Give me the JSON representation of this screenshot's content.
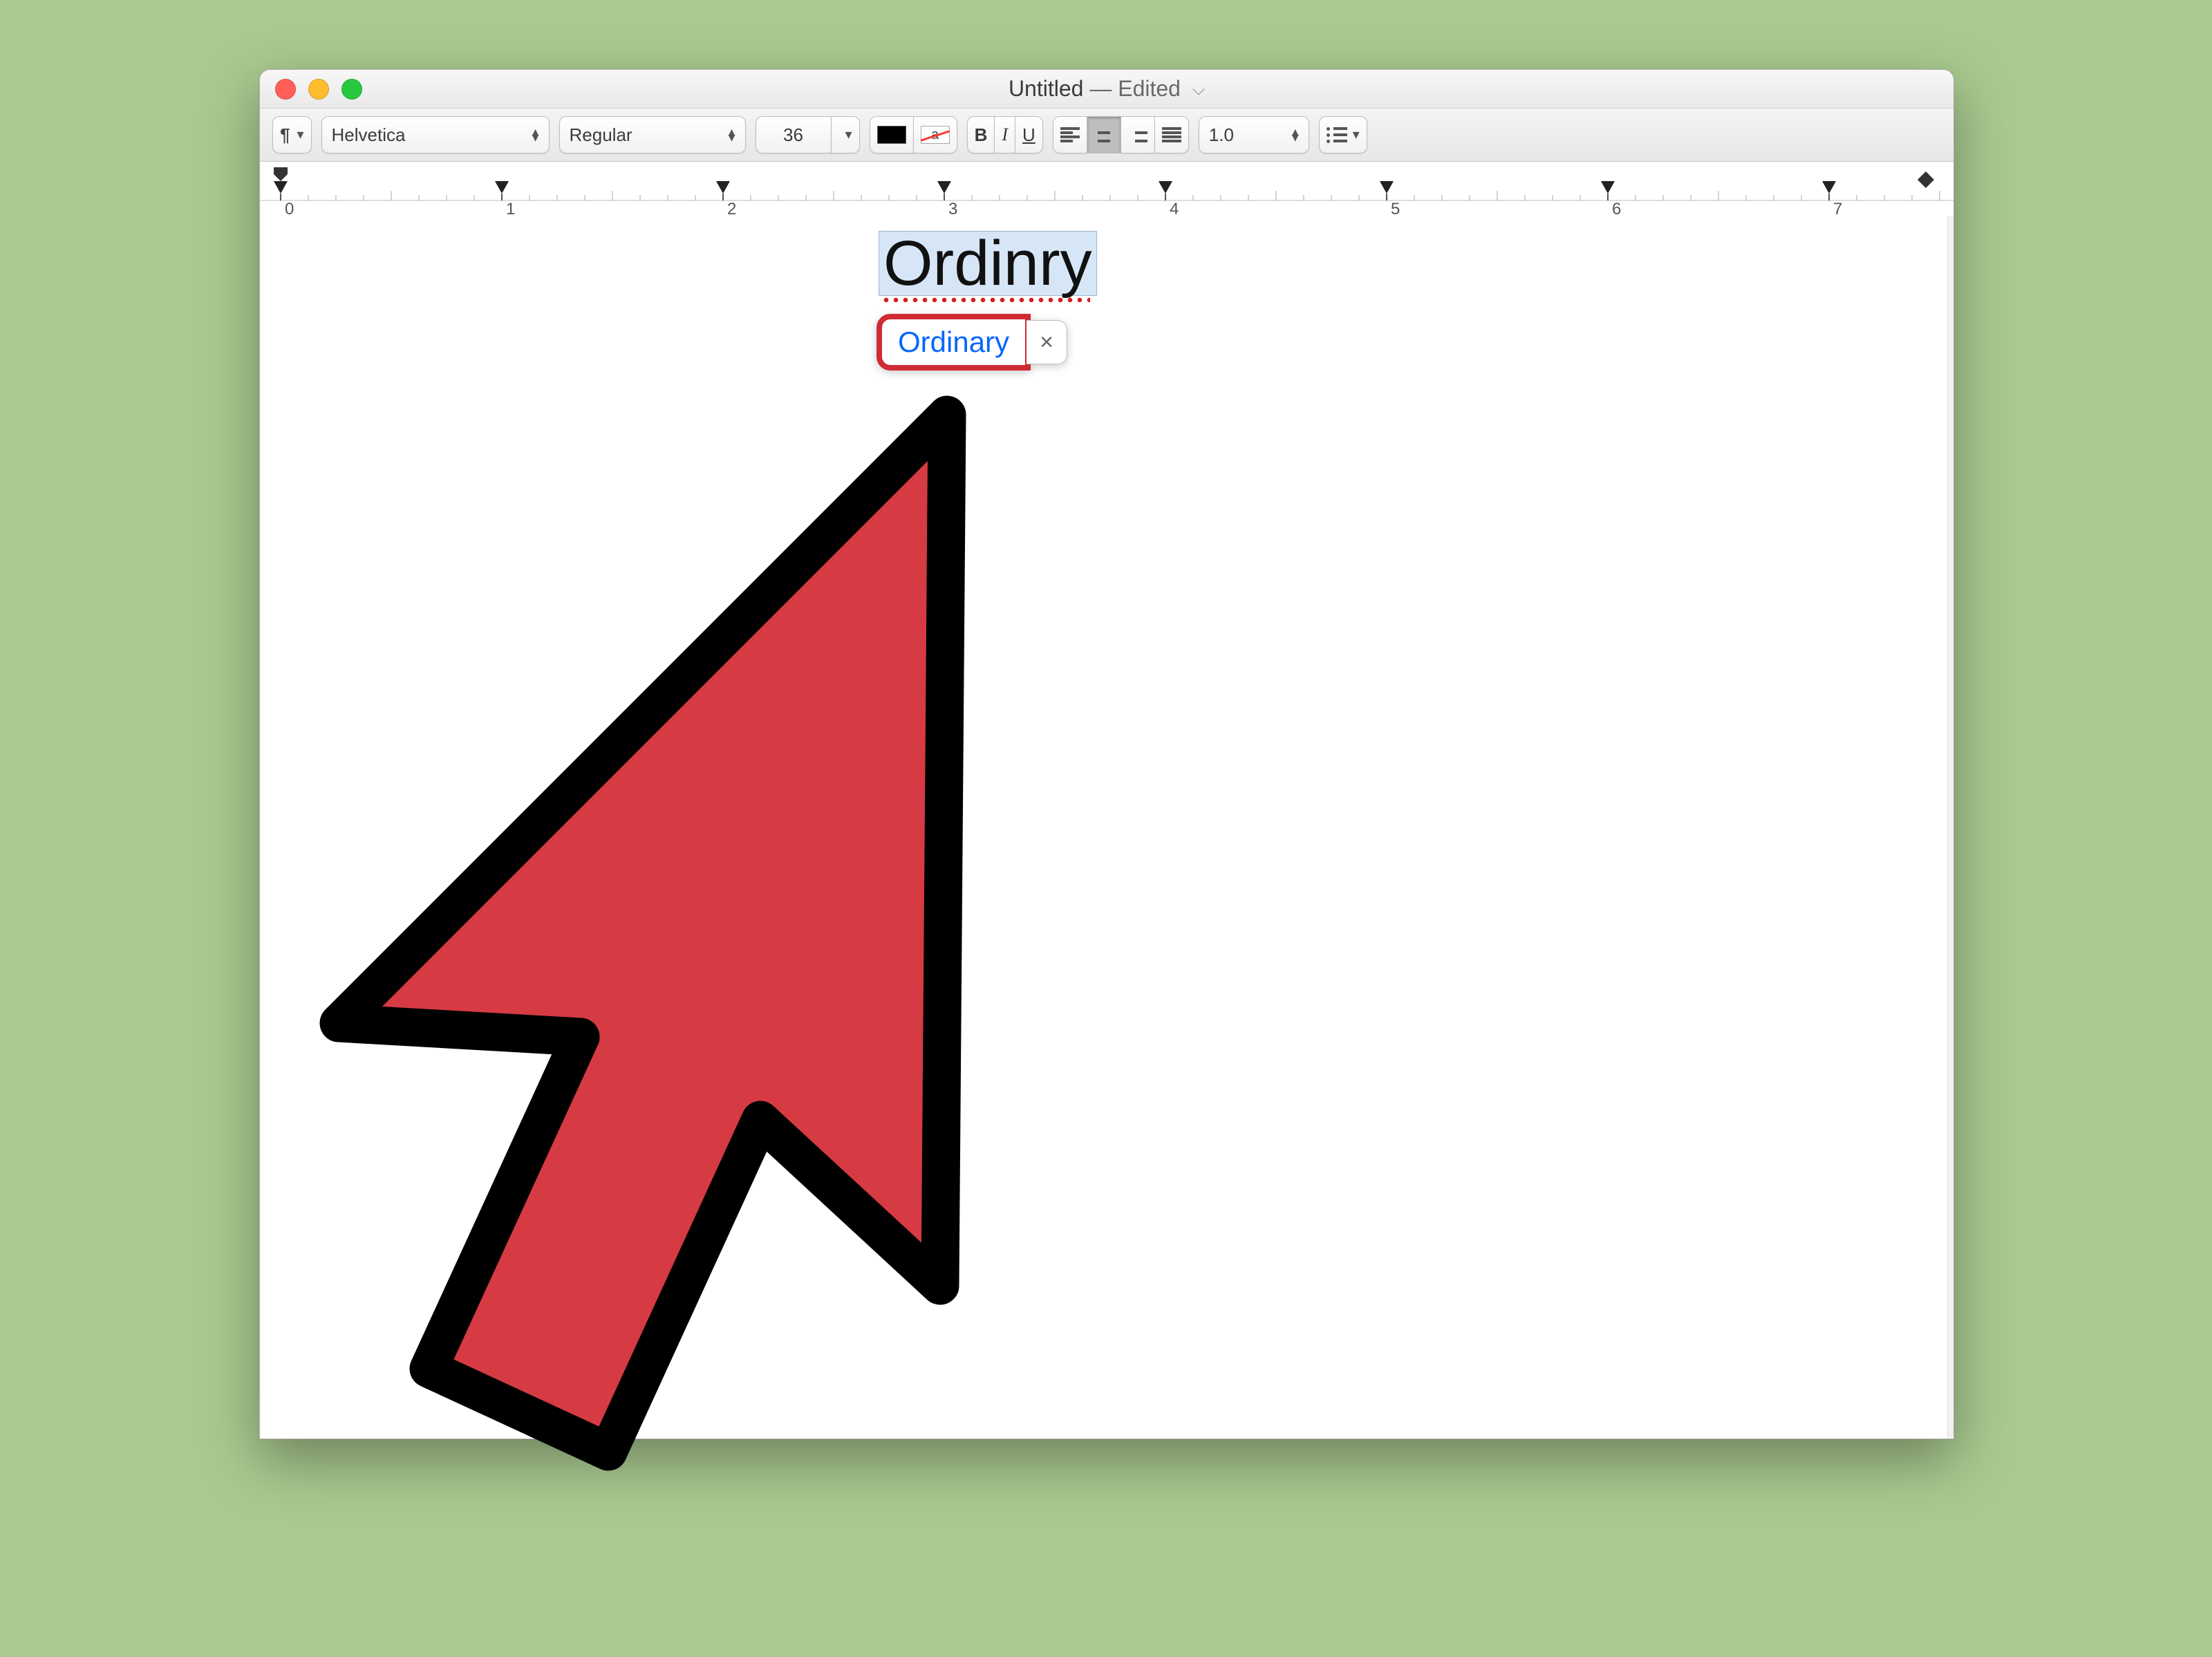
{
  "window": {
    "title_main": "Untitled",
    "title_sep": " — ",
    "title_status": "Edited"
  },
  "toolbar": {
    "paragraph_glyph": "¶",
    "font_family": "Helvetica",
    "font_style": "Regular",
    "font_size": "36",
    "bold": "B",
    "italic": "I",
    "underline": "U",
    "line_spacing": "1.0",
    "stroke_glyph": "a"
  },
  "ruler": {
    "labels": [
      "0",
      "1",
      "2",
      "3",
      "4",
      "5",
      "6",
      "7"
    ]
  },
  "document": {
    "typed_text": "Ordinry",
    "suggestion": "Ordinary",
    "dismiss_glyph": "×"
  },
  "colors": {
    "bg": "#a9c98f",
    "highlight_box": "#cf2b33",
    "link": "#0866ff",
    "cursor_fill": "#d63a42",
    "cursor_stroke": "#000000"
  }
}
